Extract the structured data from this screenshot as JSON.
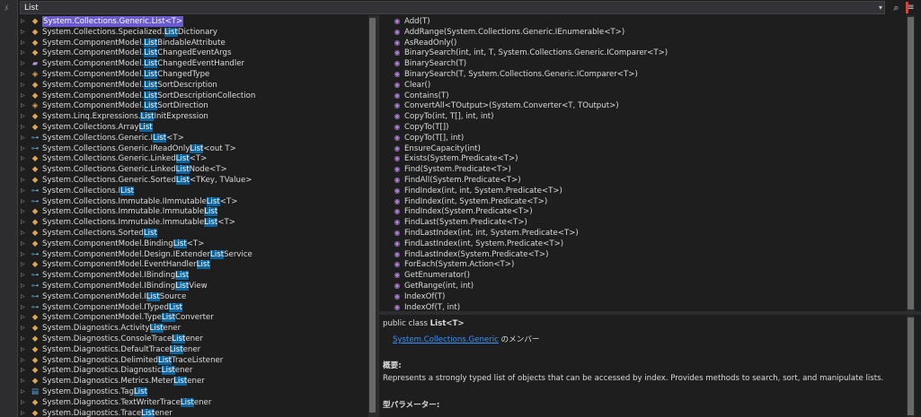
{
  "gutter_glyph": "ﾒ",
  "search": {
    "value": "List",
    "dropdown_glyph": "▾",
    "search_glyph": "⌕",
    "settings_glyph": "≡"
  },
  "tree": [
    {
      "icon": "class",
      "icon_glyph": "◆",
      "expander": "▷",
      "selected": true,
      "parts": [
        "System.Collections.Generic.",
        "!List",
        "<T>"
      ]
    },
    {
      "icon": "class",
      "icon_glyph": "◆",
      "expander": "▷",
      "parts": [
        "System.Collections.Specialized.",
        "!List",
        "Dictionary"
      ]
    },
    {
      "icon": "class",
      "icon_glyph": "◆",
      "expander": "▷",
      "parts": [
        "System.ComponentModel.",
        "!List",
        "BindableAttribute"
      ]
    },
    {
      "icon": "class",
      "icon_glyph": "◆",
      "expander": "▷",
      "parts": [
        "System.ComponentModel.",
        "!List",
        "ChangedEventArgs"
      ]
    },
    {
      "icon": "delegate",
      "icon_glyph": "▰",
      "expander": "▷",
      "parts": [
        "System.ComponentModel.",
        "!List",
        "ChangedEventHandler"
      ]
    },
    {
      "icon": "enum",
      "icon_glyph": "◈",
      "expander": "▷",
      "parts": [
        "System.ComponentModel.",
        "!List",
        "ChangedType"
      ]
    },
    {
      "icon": "class",
      "icon_glyph": "◆",
      "expander": "▷",
      "parts": [
        "System.ComponentModel.",
        "!List",
        "SortDescription"
      ]
    },
    {
      "icon": "class",
      "icon_glyph": "◆",
      "expander": "▷",
      "parts": [
        "System.ComponentModel.",
        "!List",
        "SortDescriptionCollection"
      ]
    },
    {
      "icon": "enum",
      "icon_glyph": "◈",
      "expander": "▷",
      "parts": [
        "System.ComponentModel.",
        "!List",
        "SortDirection"
      ]
    },
    {
      "icon": "class",
      "icon_glyph": "◆",
      "expander": "▷",
      "parts": [
        "System.Linq.Expressions.",
        "!List",
        "InitExpression"
      ]
    },
    {
      "icon": "class",
      "icon_glyph": "◆",
      "expander": "▷",
      "parts": [
        "System.Collections.Array",
        "!List",
        ""
      ]
    },
    {
      "icon": "interface",
      "icon_glyph": "⊶",
      "expander": "▷",
      "parts": [
        "System.Collections.Generic.I",
        "!List",
        "<T>"
      ]
    },
    {
      "icon": "interface",
      "icon_glyph": "⊶",
      "expander": "▷",
      "parts": [
        "System.Collections.Generic.IReadOnly",
        "!List",
        "<out T>"
      ]
    },
    {
      "icon": "class",
      "icon_glyph": "◆",
      "expander": "▷",
      "parts": [
        "System.Collections.Generic.Linked",
        "!List",
        "<T>"
      ]
    },
    {
      "icon": "class",
      "icon_glyph": "◆",
      "expander": "▷",
      "parts": [
        "System.Collections.Generic.Linked",
        "!List",
        "Node<T>"
      ]
    },
    {
      "icon": "class",
      "icon_glyph": "◆",
      "expander": "▷",
      "parts": [
        "System.Collections.Generic.Sorted",
        "!List",
        "<TKey, TValue>"
      ]
    },
    {
      "icon": "interface",
      "icon_glyph": "⊶",
      "expander": "▷",
      "parts": [
        "System.Collections.I",
        "!List",
        ""
      ]
    },
    {
      "icon": "interface",
      "icon_glyph": "⊶",
      "expander": "▷",
      "parts": [
        "System.Collections.Immutable.IImmutable",
        "!List",
        "<T>"
      ]
    },
    {
      "icon": "class",
      "icon_glyph": "◆",
      "expander": "▷",
      "parts": [
        "System.Collections.Immutable.Immutable",
        "!List",
        ""
      ]
    },
    {
      "icon": "class",
      "icon_glyph": "◆",
      "expander": "▷",
      "parts": [
        "System.Collections.Immutable.Immutable",
        "!List",
        "<T>"
      ]
    },
    {
      "icon": "class",
      "icon_glyph": "◆",
      "expander": "▷",
      "parts": [
        "System.Collections.Sorted",
        "!List",
        ""
      ]
    },
    {
      "icon": "class",
      "icon_glyph": "◆",
      "expander": "▷",
      "parts": [
        "System.ComponentModel.Binding",
        "!List",
        "<T>"
      ]
    },
    {
      "icon": "interface",
      "icon_glyph": "⊶",
      "expander": "▷",
      "parts": [
        "System.ComponentModel.Design.IExtender",
        "!List",
        "Service"
      ]
    },
    {
      "icon": "class",
      "icon_glyph": "◆",
      "expander": "▷",
      "parts": [
        "System.ComponentModel.EventHandler",
        "!List",
        ""
      ]
    },
    {
      "icon": "interface",
      "icon_glyph": "⊶",
      "expander": "▷",
      "parts": [
        "System.ComponentModel.IBinding",
        "!List",
        ""
      ]
    },
    {
      "icon": "interface",
      "icon_glyph": "⊶",
      "expander": "▷",
      "parts": [
        "System.ComponentModel.IBinding",
        "!List",
        "View"
      ]
    },
    {
      "icon": "interface",
      "icon_glyph": "⊶",
      "expander": "▷",
      "parts": [
        "System.ComponentModel.I",
        "!List",
        "Source"
      ]
    },
    {
      "icon": "interface",
      "icon_glyph": "⊶",
      "expander": "▷",
      "parts": [
        "System.ComponentModel.ITyped",
        "!List",
        ""
      ]
    },
    {
      "icon": "class",
      "icon_glyph": "◆",
      "expander": "▷",
      "parts": [
        "System.ComponentModel.Type",
        "!List",
        "Converter"
      ]
    },
    {
      "icon": "class",
      "icon_glyph": "◆",
      "expander": "▷",
      "parts": [
        "System.Diagnostics.Activity",
        "!List",
        "ener"
      ]
    },
    {
      "icon": "class",
      "icon_glyph": "◆",
      "expander": "▷",
      "parts": [
        "System.Diagnostics.ConsoleTrace",
        "!List",
        "ener"
      ]
    },
    {
      "icon": "class",
      "icon_glyph": "◆",
      "expander": "▷",
      "parts": [
        "System.Diagnostics.DefaultTrace",
        "!List",
        "ener"
      ]
    },
    {
      "icon": "class",
      "icon_glyph": "◆",
      "expander": "▷",
      "parts": [
        "System.Diagnostics.Delimited",
        "!List",
        "TraceListener"
      ]
    },
    {
      "icon": "class",
      "icon_glyph": "◆",
      "expander": "▷",
      "parts": [
        "System.Diagnostics.Diagnostic",
        "!List",
        "ener"
      ]
    },
    {
      "icon": "class",
      "icon_glyph": "◆",
      "expander": "▷",
      "parts": [
        "System.Diagnostics.Metrics.Meter",
        "!List",
        "ener"
      ]
    },
    {
      "icon": "struct",
      "icon_glyph": "▤",
      "expander": "▷",
      "parts": [
        "System.Diagnostics.Tag",
        "!List",
        ""
      ]
    },
    {
      "icon": "class",
      "icon_glyph": "◆",
      "expander": "▷",
      "parts": [
        "System.Diagnostics.TextWriterTrace",
        "!List",
        "ener"
      ]
    },
    {
      "icon": "class",
      "icon_glyph": "◆",
      "expander": "▷",
      "parts": [
        "System.Diagnostics.Trace",
        "!List",
        "ener"
      ]
    }
  ],
  "members": [
    "Add(T)",
    "AddRange(System.Collections.Generic.IEnumerable<T>)",
    "AsReadOnly()",
    "BinarySearch(int, int, T, System.Collections.Generic.IComparer<T>)",
    "BinarySearch(T)",
    "BinarySearch(T, System.Collections.Generic.IComparer<T>)",
    "Clear()",
    "Contains(T)",
    "ConvertAll<TOutput>(System.Converter<T, TOutput>)",
    "CopyTo(int, T[], int, int)",
    "CopyTo(T[])",
    "CopyTo(T[], int)",
    "EnsureCapacity(int)",
    "Exists(System.Predicate<T>)",
    "Find(System.Predicate<T>)",
    "FindAll(System.Predicate<T>)",
    "FindIndex(int, int, System.Predicate<T>)",
    "FindIndex(int, System.Predicate<T>)",
    "FindIndex(System.Predicate<T>)",
    "FindLast(System.Predicate<T>)",
    "FindLastIndex(int, int, System.Predicate<T>)",
    "FindLastIndex(int, System.Predicate<T>)",
    "FindLastIndex(System.Predicate<T>)",
    "ForEach(System.Action<T>)",
    "GetEnumerator()",
    "GetRange(int, int)",
    "IndexOf(T)",
    "IndexOf(T, int)"
  ],
  "member_icon_glyph": "◉",
  "description": {
    "decl_prefix": "public class ",
    "type_name": "List<T>",
    "namespace_link": "System.Collections.Generic",
    "member_of_suffix": " のメンバー",
    "summary_heading": "概要:",
    "summary": "Represents a strongly typed list of objects that can be accessed by index. Provides methods to search, sort, and manipulate lists.",
    "type_params_heading": "型パラメーター:"
  },
  "colors": {
    "background": "#1e1e1e",
    "selection": "#6a5acd",
    "match_highlight": "#0e639c",
    "link": "#3794ff"
  }
}
